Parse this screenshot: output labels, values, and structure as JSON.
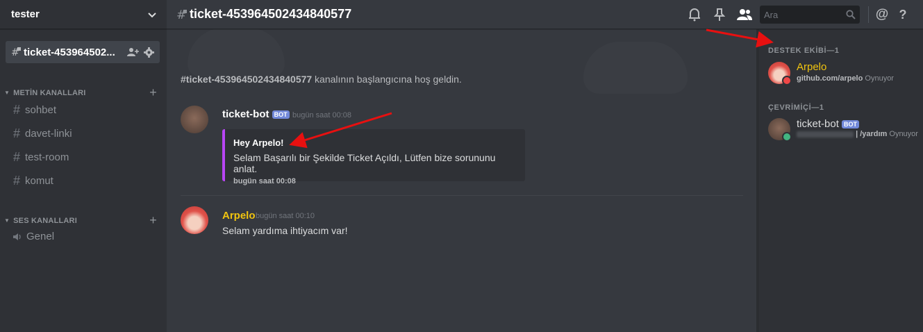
{
  "sidebar": {
    "guild_name": "tester",
    "selected_channel": "ticket-453964502...",
    "categories": [
      {
        "label": "METİN KANALLARI",
        "channels": [
          "sohbet",
          "davet-linki",
          "test-room",
          "komut"
        ]
      },
      {
        "label": "SES KANALLARI",
        "channels": [
          "Genel"
        ]
      }
    ]
  },
  "header": {
    "channel_title": "ticket-453964502434840577",
    "search_placeholder": "Ara"
  },
  "chat": {
    "welcome_channel": "#ticket-453964502434840577",
    "welcome_text": " kanalının başlangıcına hoş geldin.",
    "messages": [
      {
        "author": "ticket-bot",
        "bot_tag": "BOT",
        "timestamp": "bugün saat 00:08",
        "author_color": "#ffffff",
        "embed": {
          "title": "Hey Arpelo!",
          "description": "Selam Başarılı bir Şekilde Ticket Açıldı, Lütfen bize sorununu anlat.",
          "footer": "bugün saat 00:08",
          "accent": "#b845f5"
        }
      },
      {
        "author": "Arpelo",
        "timestamp": "bugün saat 00:10",
        "author_color": "#f1c40f",
        "content": "Selam yardıma ihtiyacım var!"
      }
    ]
  },
  "members": {
    "groups": [
      {
        "label": "DESTEK EKİBİ—1",
        "members": [
          {
            "name": "Arpelo",
            "name_color": "#f1c40f",
            "activity_bold": "github.com/arpelo",
            "activity": " Oynuyor",
            "status": "dnd",
            "status_color": "#f04747"
          }
        ]
      },
      {
        "label": "ÇEVRİMİÇİ—1",
        "members": [
          {
            "name": "ticket-bot",
            "bot_tag": "BOT",
            "name_color": "#dcddde",
            "activity_bold": "| /yardım",
            "activity": " Oynuyor",
            "status": "online",
            "status_color": "#43b581"
          }
        ]
      }
    ]
  }
}
